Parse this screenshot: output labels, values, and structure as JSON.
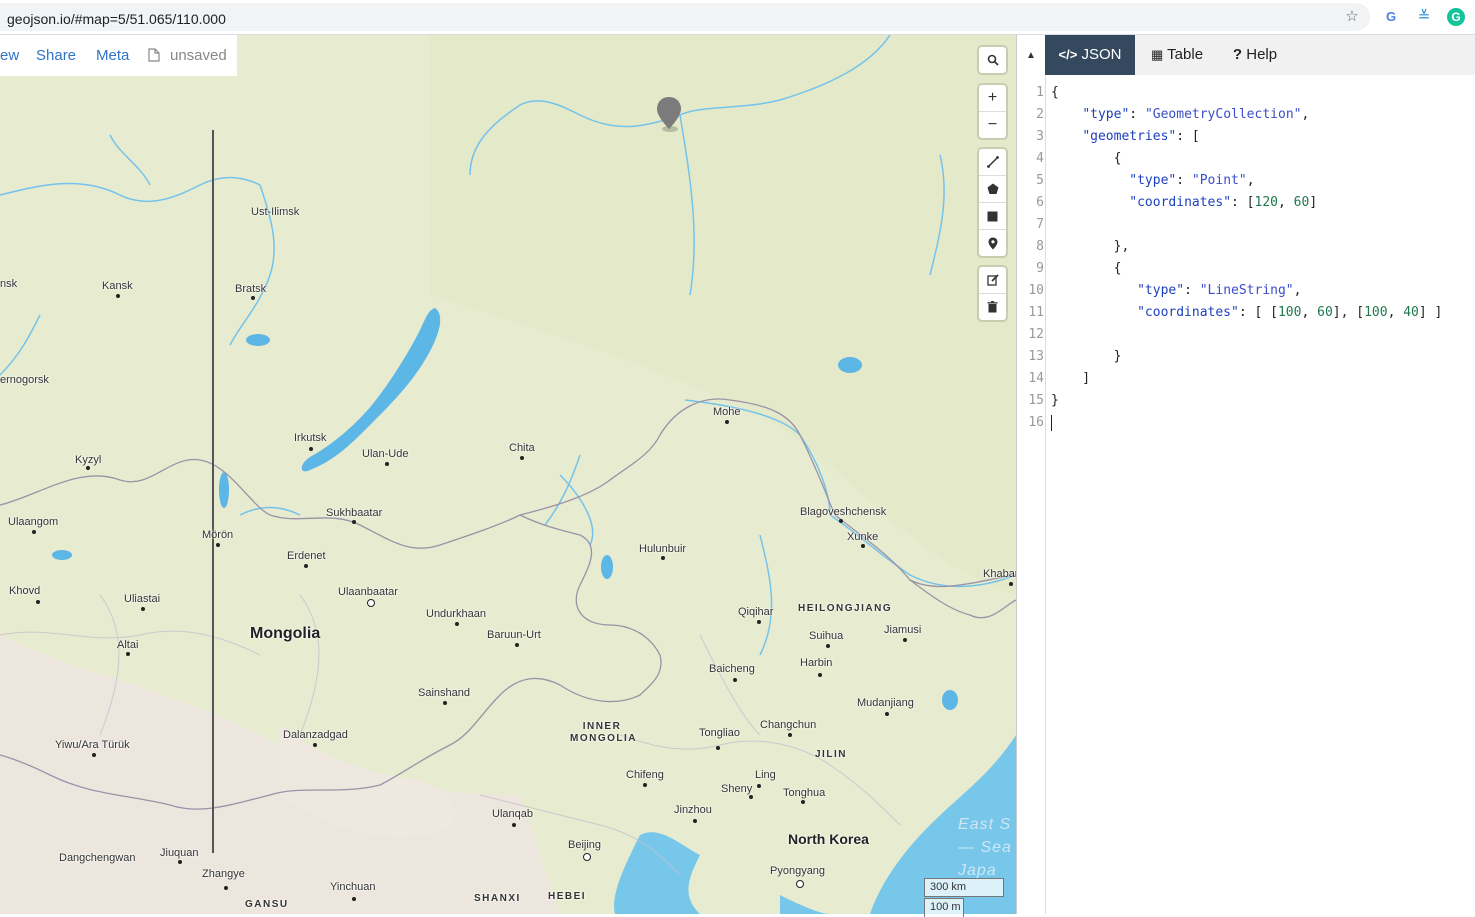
{
  "browser": {
    "url": "geojson.io/#map=5/51.065/110.000",
    "star_icon": "star-icon",
    "extensions": [
      "translate-icon",
      "feedly-icon",
      "grammarly-icon"
    ]
  },
  "toolbar": {
    "items": [
      "ew",
      "Share",
      "Meta"
    ],
    "unsaved_label": "unsaved"
  },
  "map": {
    "places": [
      {
        "name": "Ust-Ilimsk",
        "dot": false
      },
      {
        "name": "Kansk",
        "dot": true
      },
      {
        "name": "Bratsk",
        "dot": true
      },
      {
        "name": "nsk",
        "dot": false
      },
      {
        "name": "ernogorsk",
        "dot": false
      },
      {
        "name": "Irkutsk",
        "dot": true
      },
      {
        "name": "Ulan-Ude",
        "dot": true
      },
      {
        "name": "Chita",
        "dot": true
      },
      {
        "name": "Mohe",
        "dot": true
      },
      {
        "name": "Kyzyl",
        "dot": true
      },
      {
        "name": "Ulaangom",
        "dot": true
      },
      {
        "name": "Mörön",
        "dot": true
      },
      {
        "name": "Sukhbaatar",
        "dot": true
      },
      {
        "name": "Blagoveshchensk",
        "dot": true
      },
      {
        "name": "Xunke",
        "dot": true
      },
      {
        "name": "Erdenet",
        "dot": true
      },
      {
        "name": "Hulunbuir",
        "dot": true
      },
      {
        "name": "Khovd",
        "dot": true
      },
      {
        "name": "Uliastai",
        "dot": true
      },
      {
        "name": "Ulaanbaatar",
        "dot": true
      },
      {
        "name": "Khabar",
        "dot": true
      },
      {
        "name": "Undurkhaan",
        "dot": true
      },
      {
        "name": "Qiqihar",
        "dot": true
      },
      {
        "name": "Baruun-Urt",
        "dot": true
      },
      {
        "name": "Suihua",
        "dot": true
      },
      {
        "name": "Jiamusi",
        "dot": true
      },
      {
        "name": "Altai",
        "dot": true
      },
      {
        "name": "Harbin",
        "dot": true
      },
      {
        "name": "Baicheng",
        "dot": true
      },
      {
        "name": "Sainshand",
        "dot": true
      },
      {
        "name": "Mudanjiang",
        "dot": true
      },
      {
        "name": "Dalanzadgad",
        "dot": true
      },
      {
        "name": "Changchun",
        "dot": true
      },
      {
        "name": "Tongliao",
        "dot": true
      },
      {
        "name": "Yiwu/Ara Türük",
        "dot": true
      },
      {
        "name": "Chifeng",
        "dot": true
      },
      {
        "name": "Ling",
        "dot": true
      },
      {
        "name": "Sheny",
        "dot": true
      },
      {
        "name": "Tonghua",
        "dot": true
      },
      {
        "name": "Jinzhou",
        "dot": true
      },
      {
        "name": "Ulanqab",
        "dot": true
      },
      {
        "name": "Beijing",
        "dot": true
      },
      {
        "name": "Dangchengwan",
        "dot": false
      },
      {
        "name": "Jiuquan",
        "dot": true
      },
      {
        "name": "Pyongyang",
        "dot": true
      },
      {
        "name": "Zhangye",
        "dot": true
      },
      {
        "name": "Yinchuan",
        "dot": true
      }
    ],
    "country_label": "Mongolia",
    "north_korea_label": "North Korea",
    "regions": [
      "HEILONGJIANG",
      "INNER MONGOLIA",
      "JILIN",
      "SHANXI",
      "HEBEI",
      "GANSU"
    ],
    "sea_label": "East S — Sea Japa",
    "scale_labels": [
      "300 km",
      "100 m"
    ]
  },
  "controls": {
    "search_icon": "search-icon",
    "zoom_in": "+",
    "zoom_out": "−",
    "draw_tools": [
      "draw-line-icon",
      "draw-polygon-icon",
      "draw-rectangle-icon",
      "draw-marker-icon"
    ],
    "edit_tools": [
      "edit-icon",
      "delete-icon"
    ]
  },
  "panel": {
    "tabs": [
      {
        "label": "JSON",
        "icon": "code-icon",
        "active": true
      },
      {
        "label": "Table",
        "icon": "table-icon",
        "active": false
      },
      {
        "label": "Help",
        "icon": "help-icon",
        "active": false
      }
    ],
    "collapse_icon": "collapse-arrow-icon",
    "line_numbers": [
      "1",
      "2",
      "3",
      "4",
      "5",
      "6",
      "7",
      "8",
      "9",
      "10",
      "11",
      "12",
      "13",
      "14",
      "15",
      "16"
    ],
    "code": {
      "l1": "{",
      "type_key": "\"type\"",
      "type_val": "\"GeometryCollection\"",
      "geom_key": "\"geometries\"",
      "point_type_val": "\"Point\"",
      "coords_key": "\"coordinates\"",
      "point_coords": [
        "120",
        "60"
      ],
      "line_type_val": "\"LineString\"",
      "line_coords": [
        "100",
        "60",
        "100",
        "40"
      ]
    }
  }
}
